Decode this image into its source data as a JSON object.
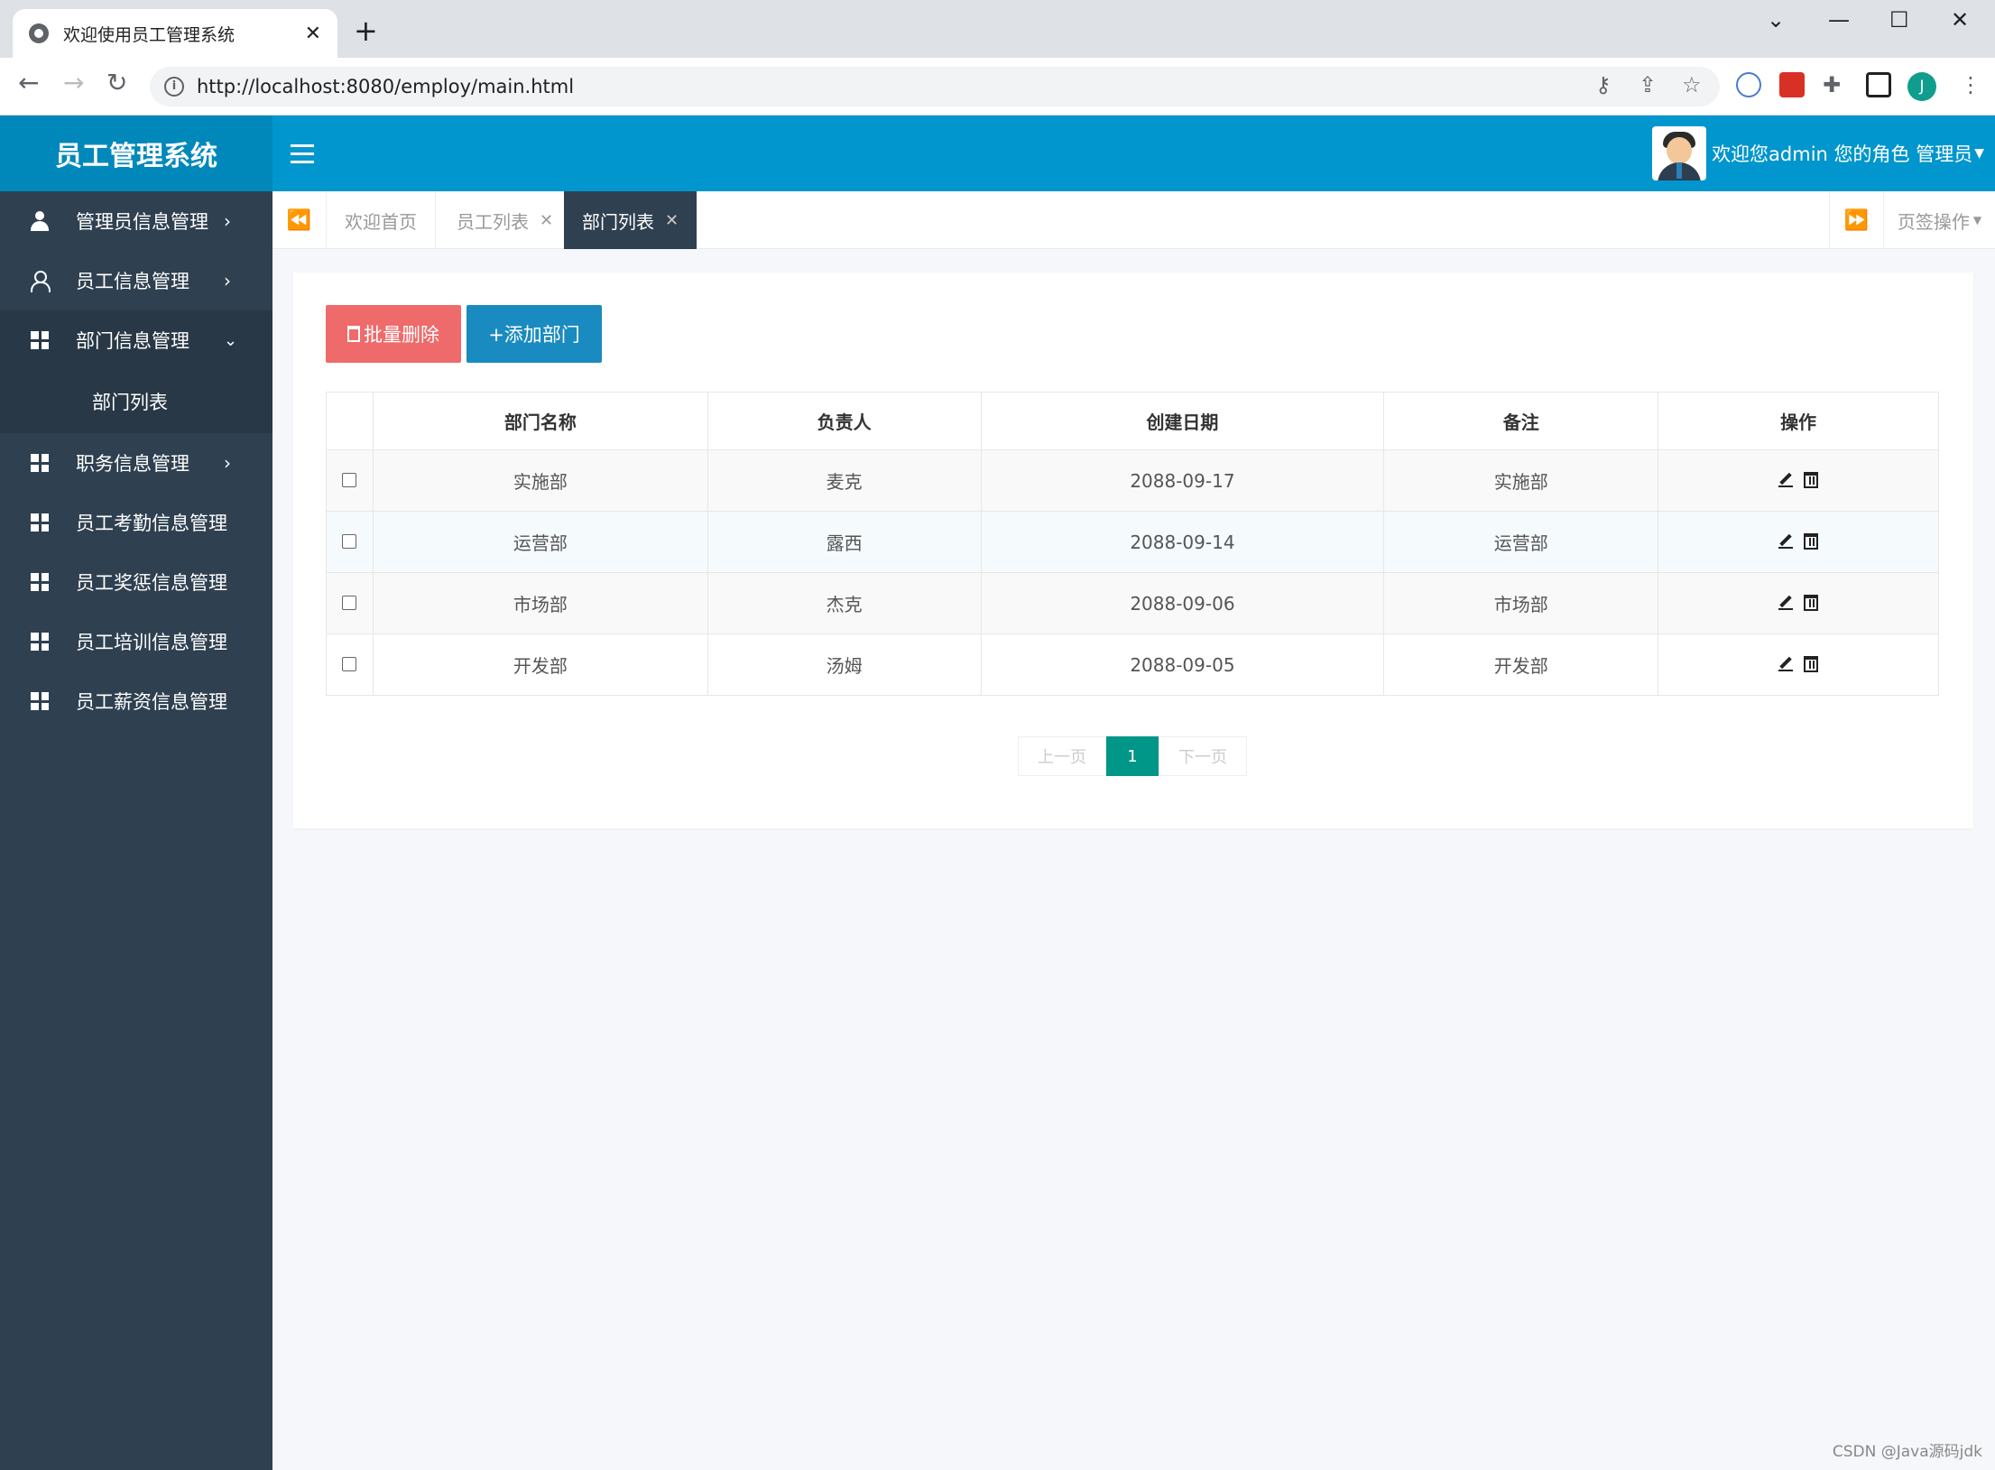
{
  "browser": {
    "tab_title": "欢迎使用员工管理系统",
    "url": "http://localhost:8080/employ/main.html",
    "profile_initial": "J"
  },
  "app": {
    "logo": "员工管理系统",
    "user_text": "欢迎您admin 您的角色 管理员",
    "accent_color": "#0196cd",
    "sidebar_color": "#2f4050"
  },
  "sidebar": {
    "items": [
      {
        "label": "管理员信息管理",
        "icon": "admin-icon"
      },
      {
        "label": "员工信息管理",
        "icon": "user-icon"
      },
      {
        "label": "部门信息管理",
        "icon": "grid-icon"
      },
      {
        "label": "职务信息管理",
        "icon": "grid-icon"
      },
      {
        "label": "员工考勤信息管理",
        "icon": "grid-icon"
      },
      {
        "label": "员工奖惩信息管理",
        "icon": "grid-icon"
      },
      {
        "label": "员工培训信息管理",
        "icon": "grid-icon"
      },
      {
        "label": "员工薪资信息管理",
        "icon": "grid-icon"
      }
    ],
    "sub_item": "部门列表"
  },
  "page_tabs": {
    "tabs": [
      "欢迎首页",
      "员工列表",
      "部门列表"
    ],
    "ops_label": "页签操作"
  },
  "toolbar": {
    "batch_delete": "批量删除",
    "add_dept": "+添加部门"
  },
  "table": {
    "headers": [
      "部门名称",
      "负责人",
      "创建日期",
      "备注",
      "操作"
    ],
    "rows": [
      {
        "name": "实施部",
        "manager": "麦克",
        "date": "2088-09-17",
        "remark": "实施部"
      },
      {
        "name": "运营部",
        "manager": "露西",
        "date": "2088-09-14",
        "remark": "运营部"
      },
      {
        "name": "市场部",
        "manager": "杰克",
        "date": "2088-09-06",
        "remark": "市场部"
      },
      {
        "name": "开发部",
        "manager": "汤姆",
        "date": "2088-09-05",
        "remark": "开发部"
      }
    ]
  },
  "pager": {
    "prev": "上一页",
    "current": "1",
    "next": "下一页"
  },
  "watermark": "CSDN @Java源码jdk"
}
